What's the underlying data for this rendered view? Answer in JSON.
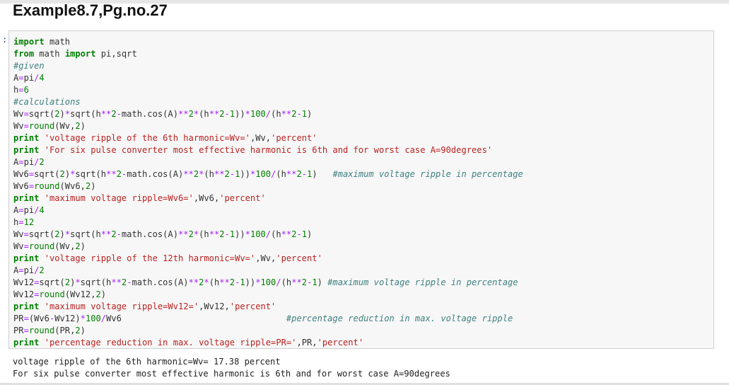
{
  "title": "Example8.7,Pg.no.27",
  "prompt": ":",
  "code_lines": [
    [
      {
        "t": "kw",
        "v": "import"
      },
      {
        "t": "p",
        "v": " math"
      }
    ],
    [
      {
        "t": "kw",
        "v": "from"
      },
      {
        "t": "p",
        "v": " math "
      },
      {
        "t": "kw",
        "v": "import"
      },
      {
        "t": "p",
        "v": " pi,sqrt"
      }
    ],
    [
      {
        "t": "com",
        "v": "#given"
      }
    ],
    [
      {
        "t": "p",
        "v": "A"
      },
      {
        "t": "op",
        "v": "="
      },
      {
        "t": "p",
        "v": "pi"
      },
      {
        "t": "op",
        "v": "/"
      },
      {
        "t": "num",
        "v": "4"
      }
    ],
    [
      {
        "t": "p",
        "v": "h"
      },
      {
        "t": "op",
        "v": "="
      },
      {
        "t": "num",
        "v": "6"
      }
    ],
    [
      {
        "t": "com",
        "v": "#calculations"
      }
    ],
    [
      {
        "t": "p",
        "v": "Wv"
      },
      {
        "t": "op",
        "v": "="
      },
      {
        "t": "p",
        "v": "sqrt("
      },
      {
        "t": "num",
        "v": "2"
      },
      {
        "t": "p",
        "v": ")"
      },
      {
        "t": "op",
        "v": "*"
      },
      {
        "t": "p",
        "v": "sqrt(h"
      },
      {
        "t": "op",
        "v": "**"
      },
      {
        "t": "num",
        "v": "2"
      },
      {
        "t": "op",
        "v": "-"
      },
      {
        "t": "p",
        "v": "math.cos(A)"
      },
      {
        "t": "op",
        "v": "**"
      },
      {
        "t": "num",
        "v": "2"
      },
      {
        "t": "op",
        "v": "*"
      },
      {
        "t": "p",
        "v": "(h"
      },
      {
        "t": "op",
        "v": "**"
      },
      {
        "t": "num",
        "v": "2"
      },
      {
        "t": "op",
        "v": "-"
      },
      {
        "t": "num",
        "v": "1"
      },
      {
        "t": "p",
        "v": "))"
      },
      {
        "t": "op",
        "v": "*"
      },
      {
        "t": "num",
        "v": "100"
      },
      {
        "t": "op",
        "v": "/"
      },
      {
        "t": "p",
        "v": "(h"
      },
      {
        "t": "op",
        "v": "**"
      },
      {
        "t": "num",
        "v": "2"
      },
      {
        "t": "op",
        "v": "-"
      },
      {
        "t": "num",
        "v": "1"
      },
      {
        "t": "p",
        "v": ")"
      }
    ],
    [
      {
        "t": "p",
        "v": "Wv"
      },
      {
        "t": "op",
        "v": "="
      },
      {
        "t": "fn",
        "v": "round"
      },
      {
        "t": "p",
        "v": "(Wv,"
      },
      {
        "t": "num",
        "v": "2"
      },
      {
        "t": "p",
        "v": ")"
      }
    ],
    [
      {
        "t": "kw",
        "v": "print"
      },
      {
        "t": "p",
        "v": " "
      },
      {
        "t": "str",
        "v": "'voltage ripple of the 6th harmonic=Wv='"
      },
      {
        "t": "p",
        "v": ",Wv,"
      },
      {
        "t": "str",
        "v": "'percent'"
      }
    ],
    [
      {
        "t": "kw",
        "v": "print"
      },
      {
        "t": "p",
        "v": " "
      },
      {
        "t": "str",
        "v": "'For six pulse converter most effective harmonic is 6th and for worst case A=90degrees'"
      }
    ],
    [
      {
        "t": "p",
        "v": "A"
      },
      {
        "t": "op",
        "v": "="
      },
      {
        "t": "p",
        "v": "pi"
      },
      {
        "t": "op",
        "v": "/"
      },
      {
        "t": "num",
        "v": "2"
      }
    ],
    [
      {
        "t": "p",
        "v": "Wv6"
      },
      {
        "t": "op",
        "v": "="
      },
      {
        "t": "p",
        "v": "sqrt("
      },
      {
        "t": "num",
        "v": "2"
      },
      {
        "t": "p",
        "v": ")"
      },
      {
        "t": "op",
        "v": "*"
      },
      {
        "t": "p",
        "v": "sqrt(h"
      },
      {
        "t": "op",
        "v": "**"
      },
      {
        "t": "num",
        "v": "2"
      },
      {
        "t": "op",
        "v": "-"
      },
      {
        "t": "p",
        "v": "math.cos(A)"
      },
      {
        "t": "op",
        "v": "**"
      },
      {
        "t": "num",
        "v": "2"
      },
      {
        "t": "op",
        "v": "*"
      },
      {
        "t": "p",
        "v": "(h"
      },
      {
        "t": "op",
        "v": "**"
      },
      {
        "t": "num",
        "v": "2"
      },
      {
        "t": "op",
        "v": "-"
      },
      {
        "t": "num",
        "v": "1"
      },
      {
        "t": "p",
        "v": "))"
      },
      {
        "t": "op",
        "v": "*"
      },
      {
        "t": "num",
        "v": "100"
      },
      {
        "t": "op",
        "v": "/"
      },
      {
        "t": "p",
        "v": "(h"
      },
      {
        "t": "op",
        "v": "**"
      },
      {
        "t": "num",
        "v": "2"
      },
      {
        "t": "op",
        "v": "-"
      },
      {
        "t": "num",
        "v": "1"
      },
      {
        "t": "p",
        "v": ")   "
      },
      {
        "t": "com",
        "v": "#maximum voltage ripple in percentage"
      }
    ],
    [
      {
        "t": "p",
        "v": "Wv6"
      },
      {
        "t": "op",
        "v": "="
      },
      {
        "t": "fn",
        "v": "round"
      },
      {
        "t": "p",
        "v": "(Wv6,"
      },
      {
        "t": "num",
        "v": "2"
      },
      {
        "t": "p",
        "v": ")"
      }
    ],
    [
      {
        "t": "kw",
        "v": "print"
      },
      {
        "t": "p",
        "v": " "
      },
      {
        "t": "str",
        "v": "'maximum voltage ripple=Wv6='"
      },
      {
        "t": "p",
        "v": ",Wv6,"
      },
      {
        "t": "str",
        "v": "'percent'"
      }
    ],
    [
      {
        "t": "p",
        "v": "A"
      },
      {
        "t": "op",
        "v": "="
      },
      {
        "t": "p",
        "v": "pi"
      },
      {
        "t": "op",
        "v": "/"
      },
      {
        "t": "num",
        "v": "4"
      }
    ],
    [
      {
        "t": "p",
        "v": "h"
      },
      {
        "t": "op",
        "v": "="
      },
      {
        "t": "num",
        "v": "12"
      }
    ],
    [
      {
        "t": "p",
        "v": "Wv"
      },
      {
        "t": "op",
        "v": "="
      },
      {
        "t": "p",
        "v": "sqrt("
      },
      {
        "t": "num",
        "v": "2"
      },
      {
        "t": "p",
        "v": ")"
      },
      {
        "t": "op",
        "v": "*"
      },
      {
        "t": "p",
        "v": "sqrt(h"
      },
      {
        "t": "op",
        "v": "**"
      },
      {
        "t": "num",
        "v": "2"
      },
      {
        "t": "op",
        "v": "-"
      },
      {
        "t": "p",
        "v": "math.cos(A)"
      },
      {
        "t": "op",
        "v": "**"
      },
      {
        "t": "num",
        "v": "2"
      },
      {
        "t": "op",
        "v": "*"
      },
      {
        "t": "p",
        "v": "(h"
      },
      {
        "t": "op",
        "v": "**"
      },
      {
        "t": "num",
        "v": "2"
      },
      {
        "t": "op",
        "v": "-"
      },
      {
        "t": "num",
        "v": "1"
      },
      {
        "t": "p",
        "v": "))"
      },
      {
        "t": "op",
        "v": "*"
      },
      {
        "t": "num",
        "v": "100"
      },
      {
        "t": "op",
        "v": "/"
      },
      {
        "t": "p",
        "v": "(h"
      },
      {
        "t": "op",
        "v": "**"
      },
      {
        "t": "num",
        "v": "2"
      },
      {
        "t": "op",
        "v": "-"
      },
      {
        "t": "num",
        "v": "1"
      },
      {
        "t": "p",
        "v": ")"
      }
    ],
    [
      {
        "t": "p",
        "v": "Wv"
      },
      {
        "t": "op",
        "v": "="
      },
      {
        "t": "fn",
        "v": "round"
      },
      {
        "t": "p",
        "v": "(Wv,"
      },
      {
        "t": "num",
        "v": "2"
      },
      {
        "t": "p",
        "v": ")"
      }
    ],
    [
      {
        "t": "kw",
        "v": "print"
      },
      {
        "t": "p",
        "v": " "
      },
      {
        "t": "str",
        "v": "'voltage ripple of the 12th harmonic=Wv='"
      },
      {
        "t": "p",
        "v": ",Wv,"
      },
      {
        "t": "str",
        "v": "'percent'"
      }
    ],
    [
      {
        "t": "p",
        "v": "A"
      },
      {
        "t": "op",
        "v": "="
      },
      {
        "t": "p",
        "v": "pi"
      },
      {
        "t": "op",
        "v": "/"
      },
      {
        "t": "num",
        "v": "2"
      }
    ],
    [
      {
        "t": "p",
        "v": "Wv12"
      },
      {
        "t": "op",
        "v": "="
      },
      {
        "t": "p",
        "v": "sqrt("
      },
      {
        "t": "num",
        "v": "2"
      },
      {
        "t": "p",
        "v": ")"
      },
      {
        "t": "op",
        "v": "*"
      },
      {
        "t": "p",
        "v": "sqrt(h"
      },
      {
        "t": "op",
        "v": "**"
      },
      {
        "t": "num",
        "v": "2"
      },
      {
        "t": "op",
        "v": "-"
      },
      {
        "t": "p",
        "v": "math.cos(A)"
      },
      {
        "t": "op",
        "v": "**"
      },
      {
        "t": "num",
        "v": "2"
      },
      {
        "t": "op",
        "v": "*"
      },
      {
        "t": "p",
        "v": "(h"
      },
      {
        "t": "op",
        "v": "**"
      },
      {
        "t": "num",
        "v": "2"
      },
      {
        "t": "op",
        "v": "-"
      },
      {
        "t": "num",
        "v": "1"
      },
      {
        "t": "p",
        "v": "))"
      },
      {
        "t": "op",
        "v": "*"
      },
      {
        "t": "num",
        "v": "100"
      },
      {
        "t": "op",
        "v": "/"
      },
      {
        "t": "p",
        "v": "(h"
      },
      {
        "t": "op",
        "v": "**"
      },
      {
        "t": "num",
        "v": "2"
      },
      {
        "t": "op",
        "v": "-"
      },
      {
        "t": "num",
        "v": "1"
      },
      {
        "t": "p",
        "v": ") "
      },
      {
        "t": "com",
        "v": "#maximum voltage ripple in percentage"
      }
    ],
    [
      {
        "t": "p",
        "v": "Wv12"
      },
      {
        "t": "op",
        "v": "="
      },
      {
        "t": "fn",
        "v": "round"
      },
      {
        "t": "p",
        "v": "(Wv12,"
      },
      {
        "t": "num",
        "v": "2"
      },
      {
        "t": "p",
        "v": ")"
      }
    ],
    [
      {
        "t": "kw",
        "v": "print"
      },
      {
        "t": "p",
        "v": " "
      },
      {
        "t": "str",
        "v": "'maximum voltage ripple=Wv12='"
      },
      {
        "t": "p",
        "v": ",Wv12,"
      },
      {
        "t": "str",
        "v": "'percent'"
      }
    ],
    [
      {
        "t": "p",
        "v": "PR"
      },
      {
        "t": "op",
        "v": "="
      },
      {
        "t": "p",
        "v": "(Wv6"
      },
      {
        "t": "op",
        "v": "-"
      },
      {
        "t": "p",
        "v": "Wv12)"
      },
      {
        "t": "op",
        "v": "*"
      },
      {
        "t": "num",
        "v": "100"
      },
      {
        "t": "op",
        "v": "/"
      },
      {
        "t": "p",
        "v": "Wv6                                "
      },
      {
        "t": "com",
        "v": "#percentage reduction in max. voltage ripple"
      }
    ],
    [
      {
        "t": "p",
        "v": "PR"
      },
      {
        "t": "op",
        "v": "="
      },
      {
        "t": "fn",
        "v": "round"
      },
      {
        "t": "p",
        "v": "(PR,"
      },
      {
        "t": "num",
        "v": "2"
      },
      {
        "t": "p",
        "v": ")"
      }
    ],
    [
      {
        "t": "kw",
        "v": "print"
      },
      {
        "t": "p",
        "v": " "
      },
      {
        "t": "str",
        "v": "'percentage reduction in max. voltage ripple=PR='"
      },
      {
        "t": "p",
        "v": ",PR,"
      },
      {
        "t": "str",
        "v": "'percent'"
      }
    ]
  ],
  "output_lines": [
    "voltage ripple of the 6th harmonic=Wv= 17.38 percent",
    "For six pulse converter most effective harmonic is 6th and for worst case A=90degrees"
  ],
  "colors": {
    "keyword": "#008000",
    "string": "#ba2121",
    "operator": "#aa22ff",
    "comment": "#408080",
    "cell_background": "#f7f7f7"
  }
}
